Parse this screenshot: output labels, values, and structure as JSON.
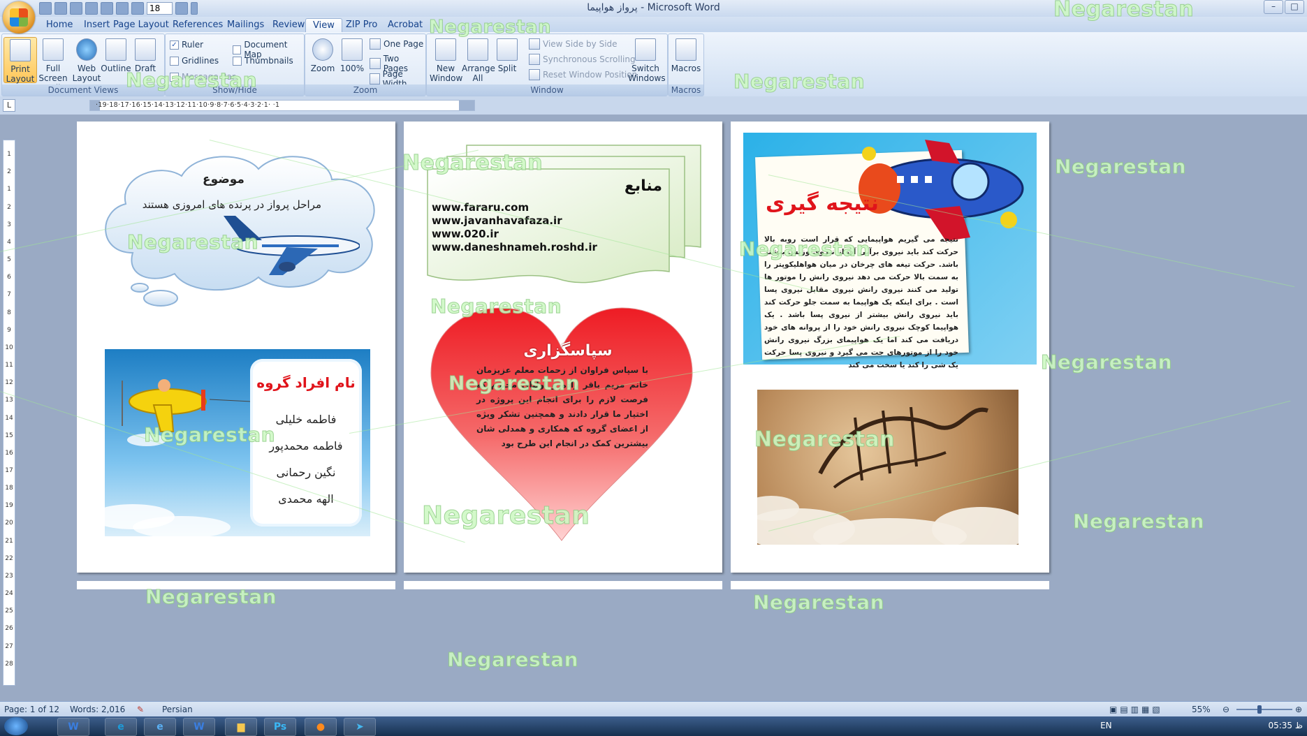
{
  "window": {
    "title": "پرواز هواپیما - Microsoft Word",
    "font_size": "18",
    "controls": [
      "–",
      "□"
    ]
  },
  "tabs": [
    "Home",
    "Insert",
    "Page Layout",
    "References",
    "Mailings",
    "Review",
    "View",
    "ZIP Pro",
    "Acrobat"
  ],
  "active_tab": "View",
  "ribbon": {
    "document_views": {
      "label": "Document Views",
      "buttons": [
        {
          "label": "Print Layout",
          "selected": true
        },
        {
          "label": "Full Screen Reading"
        },
        {
          "label": "Web Layout"
        },
        {
          "label": "Outline"
        },
        {
          "label": "Draft"
        }
      ]
    },
    "show_hide": {
      "label": "Show/Hide",
      "items": [
        {
          "label": "Ruler",
          "checked": true
        },
        {
          "label": "Gridlines",
          "checked": false
        },
        {
          "label": "Message Bar",
          "checked": false,
          "disabled": true
        },
        {
          "label": "Document Map",
          "checked": false
        },
        {
          "label": "Thumbnails",
          "checked": false
        }
      ]
    },
    "zoom": {
      "label": "Zoom",
      "buttons": [
        {
          "label": "Zoom"
        },
        {
          "label": "100%"
        }
      ],
      "small": [
        "One Page",
        "Two Pages",
        "Page Width"
      ]
    },
    "window": {
      "label": "Window",
      "buttons": [
        {
          "label": "New Window"
        },
        {
          "label": "Arrange All"
        },
        {
          "label": "Split"
        }
      ],
      "small": [
        "View Side by Side",
        "Synchronous Scrolling",
        "Reset Window Position"
      ],
      "switch": "Switch Windows"
    },
    "macros": {
      "label": "Macros",
      "button": "Macros"
    }
  },
  "ruler": {
    "corner": "L",
    "ticks": "·19·18·17·16·15·14·13·12·11·10·9·8·7·6·5·4·3·2·1·  ·1"
  },
  "vruler_numbers": [
    "1",
    "2",
    "1",
    "2",
    "3",
    "4",
    "5",
    "6",
    "7",
    "8",
    "9",
    "10",
    "11",
    "12",
    "13",
    "14",
    "15",
    "16",
    "17",
    "18",
    "19",
    "20",
    "21",
    "22",
    "23",
    "24",
    "25",
    "26",
    "27",
    "28"
  ],
  "pages": {
    "page1": {
      "topic_title": "موضوع",
      "topic_text": "مراحل پرواز در پرنده های امروزی هستند",
      "group_title": "نام افراد گروه",
      "members": [
        "فاطمه خلیلی",
        "فاطمه محمدپور",
        "نگین رحمانی",
        "الهه محمدی"
      ]
    },
    "page2": {
      "sources_title": "منابع",
      "sources": [
        "www.fararu.com",
        "www.javanhavafaza.ir",
        "www.020.ir",
        "www.daneshnameh.roshd.ir"
      ],
      "thanks_title": "سپاسگزاری",
      "thanks_text": "با سپاس فراوان از زحمات معلم عزیزمان خانم مریم باقر زاده و اولیای محترم که فرصت لازم را برای انجام این پروژه در اختیار ما قرار دادند و همچنین تشکر ویژه از اعضای گروه که همکاری و همدلی شان بیشترین کمک در انجام این طرح بود"
    },
    "page3": {
      "conclusion_title": "نتیجه گیری",
      "conclusion_text": "نتیجه می گیریم هواپیمایی که قرار است روبه بالا حرکت کند باید نیروی برآیی آن از نیروی وزنش بیشتر باشد. حرکت تیغه های چرخان در میان هواهلیکوپتر را به سمت بالا حرکت می دهد نیروی رانش را موتور ها تولید می کنند نیروی رانش نیروی مقابل نیروی پسا است . برای اینکه یک هواپیما به سمت جلو حرکت کند باید نیروی رانش بیشتر از نیروی پسا باشد . یک هواپیما کوچک نیروی رانش خود را از پروانه های خود دریافت می کند اما یک هواپیمای بزرگ نیروی رانش خود را از موتورهای جت می گیرد و نیروی پسا حرکت یک شی را کند یا سخت می کند"
    }
  },
  "status": {
    "page": "Page: 1 of 12",
    "words": "Words: 2,016",
    "language": "Persian",
    "zoom": "55%"
  },
  "taskbar": {
    "lang": "EN",
    "time": "05:35 ظ"
  },
  "watermark": "Negarestan",
  "colors": {
    "ribbon_bg": "#dbe7f6",
    "workspace": "#9aaac4",
    "title_red": "#e0141b",
    "heart_red": "#f04848"
  }
}
